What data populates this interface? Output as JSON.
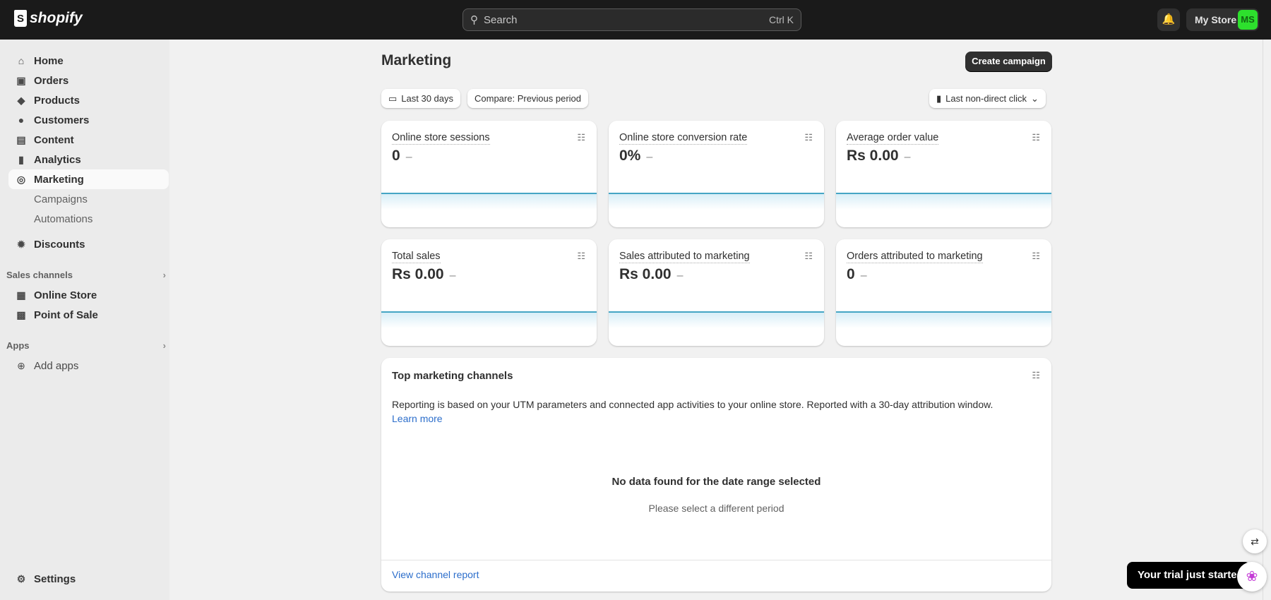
{
  "brand": "shopify",
  "search": {
    "placeholder": "Search",
    "shortcut": "Ctrl K"
  },
  "store": {
    "name": "My Store",
    "initials": "MS"
  },
  "sidebar": {
    "items": [
      {
        "label": "Home"
      },
      {
        "label": "Orders"
      },
      {
        "label": "Products"
      },
      {
        "label": "Customers"
      },
      {
        "label": "Content"
      },
      {
        "label": "Analytics"
      },
      {
        "label": "Marketing"
      }
    ],
    "sub": [
      {
        "label": "Campaigns"
      },
      {
        "label": "Automations"
      }
    ],
    "discounts": "Discounts",
    "sales_channels": "Sales channels",
    "channels": [
      {
        "label": "Online Store"
      },
      {
        "label": "Point of Sale"
      }
    ],
    "apps": "Apps",
    "add_apps": "Add apps",
    "settings": "Settings"
  },
  "page": {
    "title": "Marketing",
    "create": "Create campaign",
    "date": "Last 30 days",
    "compare": "Compare: Previous period",
    "attribution": "Last non-direct click"
  },
  "metrics": [
    {
      "label": "Online store sessions",
      "value": "0"
    },
    {
      "label": "Online store conversion rate",
      "value": "0%"
    },
    {
      "label": "Average order value",
      "value": "Rs 0.00"
    },
    {
      "label": "Total sales",
      "value": "Rs 0.00"
    },
    {
      "label": "Sales attributed to marketing",
      "value": "Rs 0.00"
    },
    {
      "label": "Orders attributed to marketing",
      "value": "0"
    }
  ],
  "dash": "–",
  "channels_card": {
    "title": "Top marketing channels",
    "desc": "Reporting is based on your UTM parameters and connected app activities to your online store. Reported with a 30-day attribution window.",
    "learn": "Learn more",
    "empty": "No data found for the date range selected",
    "hint": "Please select a different period",
    "report": "View channel report"
  },
  "toast": "Your trial just started"
}
